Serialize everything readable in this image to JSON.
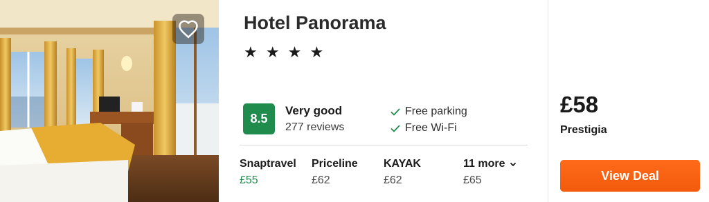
{
  "hotel": {
    "name": "Hotel Panorama",
    "stars": "★ ★ ★ ★"
  },
  "rating": {
    "score": "8.5",
    "label": "Very good",
    "reviews": "277 reviews"
  },
  "amenities": [
    "Free parking",
    "Free Wi-Fi"
  ],
  "deals": [
    {
      "provider": "Snaptravel",
      "price": "£55"
    },
    {
      "provider": "Priceline",
      "price": "£62"
    },
    {
      "provider": "KAYAK",
      "price": "£62"
    },
    {
      "provider": "11 more",
      "price": "£65"
    }
  ],
  "best": {
    "price": "£58",
    "provider": "Prestigia",
    "cta": "View Deal"
  },
  "colors": {
    "rating": "#1f8b4c",
    "cta": "#f25a0c",
    "best_price": "#1f8b4c"
  }
}
